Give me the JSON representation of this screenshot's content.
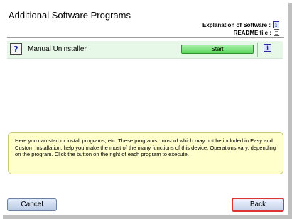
{
  "header": {
    "title": "Additional Software Programs",
    "explanation_label": "Explanation of Software :",
    "readme_label": "README file :"
  },
  "icons": {
    "info": "info-icon",
    "readme": "readme-document-icon",
    "program": "help-question-icon"
  },
  "programs": [
    {
      "name": "Manual Uninstaller",
      "action_label": "Start"
    }
  ],
  "help_text": "Here you can start or install programs, etc. These programs, most of which may not be included in Easy and Custom Installation, help you make the most of the many functions of this device. Operations vary, depending on the program. Click the button on the right of each program to execute.",
  "footer": {
    "cancel_label": "Cancel",
    "back_label": "Back"
  },
  "colors": {
    "row_background": "#e8f8e8",
    "start_button": "#5ed45e",
    "help_background": "#ffffcc",
    "back_button_border": "#dd3333"
  }
}
